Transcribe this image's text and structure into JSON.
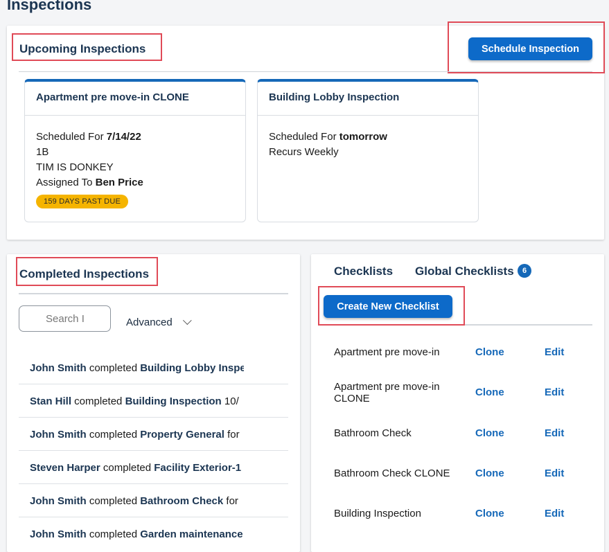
{
  "page": {
    "title": "Inspections"
  },
  "upcoming": {
    "title": "Upcoming Inspections",
    "schedule_button": "Schedule Inspection",
    "cards": [
      {
        "title": "Apartment pre move-in CLONE",
        "scheduled_label": "Scheduled For ",
        "scheduled_value": "7/14/22",
        "unit": "1B",
        "note": "TIM IS DONKEY",
        "assigned_label": "Assigned To ",
        "assigned_value": "Ben Price",
        "badge": "159 DAYS PAST DUE"
      },
      {
        "title": "Building Lobby Inspection",
        "scheduled_label": "Scheduled For ",
        "scheduled_value": "tomorrow",
        "recurs": "Recurs Weekly"
      }
    ]
  },
  "completed": {
    "title": "Completed Inspections",
    "search_placeholder": "Search I",
    "advanced_label": "Advanced",
    "rows": [
      {
        "user": "John Smith",
        "verb": " completed ",
        "item": "Building Lobby Inspe"
      },
      {
        "user": "Stan Hill",
        "verb": " completed ",
        "item": "Building Inspection",
        "rest": " 10/"
      },
      {
        "user": "John Smith",
        "verb": " completed ",
        "item": "Property General",
        "rest": " for"
      },
      {
        "user": "Steven Harper",
        "verb": " completed ",
        "item": "Facility Exterior-1"
      },
      {
        "user": "John Smith",
        "verb": " completed ",
        "item": "Bathroom Check",
        "rest": " for"
      },
      {
        "user": "John Smith",
        "verb": " completed ",
        "item": "Garden maintenance"
      }
    ]
  },
  "checklists": {
    "tabs": [
      {
        "label": "Checklists"
      },
      {
        "label": "Global Checklists",
        "count": "6"
      }
    ],
    "create_button": "Create New Checklist",
    "clone_label": "Clone",
    "edit_label": "Edit",
    "items": [
      {
        "name": "Apartment pre move-in"
      },
      {
        "name": "Apartment pre move-in CLONE"
      },
      {
        "name": "Bathroom Check"
      },
      {
        "name": "Bathroom Check CLONE"
      },
      {
        "name": "Building Inspection"
      }
    ]
  },
  "colors": {
    "accent": "#0d6ac9",
    "heading": "#1b3552",
    "badge": "#f5b400",
    "highlight": "#e04a57"
  }
}
